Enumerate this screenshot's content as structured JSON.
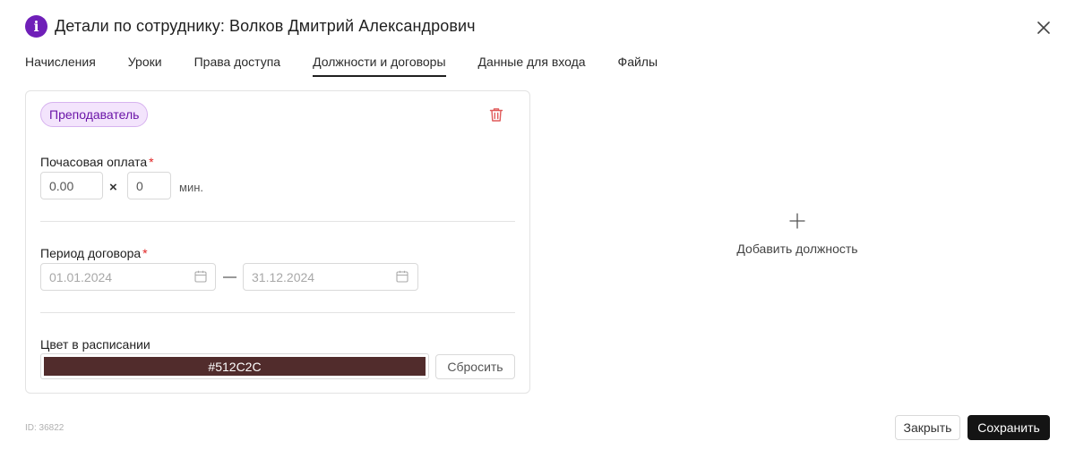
{
  "header": {
    "title": "Детали по сотруднику: Волков Дмитрий Александрович",
    "info_icon_glyph": "i",
    "icon": "info-icon",
    "accent": "#6f1fb8"
  },
  "tabs": [
    {
      "label": "Начисления",
      "active": false
    },
    {
      "label": "Уроки",
      "active": false
    },
    {
      "label": "Права доступа",
      "active": false
    },
    {
      "label": "Должности и договоры",
      "active": true
    },
    {
      "label": "Данные для входа",
      "active": false
    },
    {
      "label": "Файлы",
      "active": false
    }
  ],
  "position_card": {
    "role_tag": "Преподаватель",
    "hourly_rate": {
      "label": "Почасовая оплата",
      "required_mark": "*",
      "rate_value": "0.00",
      "times_sign": "×",
      "minutes_value": "0",
      "unit": "мин."
    },
    "contract_period": {
      "label": "Период договора",
      "required_mark": "*",
      "start_date": "01.01.2024",
      "separator": "—",
      "end_date": "31.12.2024"
    },
    "schedule_color": {
      "label": "Цвет в расписании",
      "value": "#512C2C",
      "reset_label": "Сбросить"
    }
  },
  "add_position": {
    "label": "Добавить должность"
  },
  "footer": {
    "id_text": "ID: 36822",
    "close_label": "Закрыть",
    "save_label": "Сохранить"
  }
}
